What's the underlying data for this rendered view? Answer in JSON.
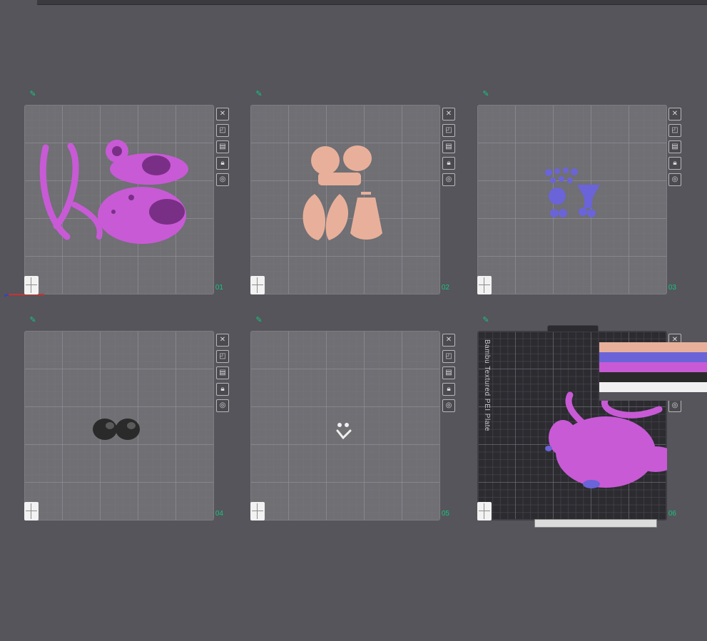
{
  "plates": [
    {
      "number": "01",
      "edit_icon": "pencil-icon"
    },
    {
      "number": "02",
      "edit_icon": "pencil-icon"
    },
    {
      "number": "03",
      "edit_icon": "pencil-icon"
    },
    {
      "number": "04",
      "edit_icon": "pencil-icon"
    },
    {
      "number": "05",
      "edit_icon": "pencil-icon"
    },
    {
      "number": "06",
      "edit_icon": "pencil-icon",
      "plate_type": "Bambu Textured PEI Plate"
    }
  ],
  "plate_tools": [
    "close-icon",
    "auto-orient-icon",
    "arrange-icon",
    "lock-icon",
    "settings-icon"
  ],
  "colors": {
    "background": "#55555b",
    "accent_green": "#19c37d",
    "magenta_part": "#c85ad6",
    "peach_part": "#e8b09a",
    "blue_part": "#6a64d8",
    "black_part": "#2a2a2a",
    "white_part": "#f0f0f0"
  },
  "filament_colors": [
    "#e8b09a",
    "#6a64d8",
    "#c85ad6",
    "#2a2a2a",
    "#f0f0f0"
  ]
}
